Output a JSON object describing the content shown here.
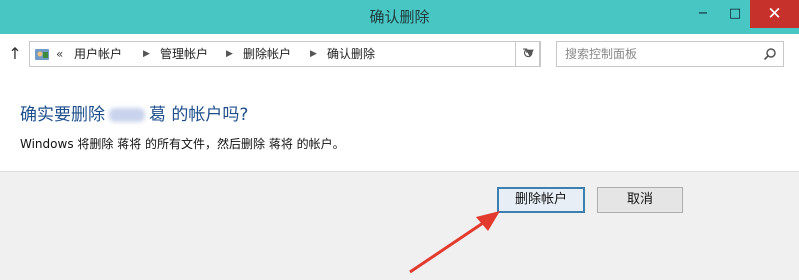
{
  "window": {
    "title": "确认删除",
    "controls": {
      "minimize": "−",
      "maximize": "□",
      "close": "✕"
    }
  },
  "nav": {
    "up_icon": "up-arrow-icon",
    "address_prefix": "«",
    "breadcrumbs": [
      "用户帐户",
      "管理帐户",
      "删除帐户",
      "确认删除"
    ],
    "search_placeholder": "搜索控制面板"
  },
  "content": {
    "heading_before": "确实要删除",
    "heading_visible_name_fragment": "葛",
    "heading_after": "的帐户吗?",
    "description": "Windows 将删除 蒋将 的所有文件，然后删除 蒋将 的帐户。"
  },
  "footer": {
    "delete_label": "删除帐户",
    "cancel_label": "取消"
  },
  "colors": {
    "titlebar": "#48c6c4",
    "close": "#c7312b",
    "heading": "#1d4f8c",
    "annotation_arrow": "#e23b2e"
  }
}
